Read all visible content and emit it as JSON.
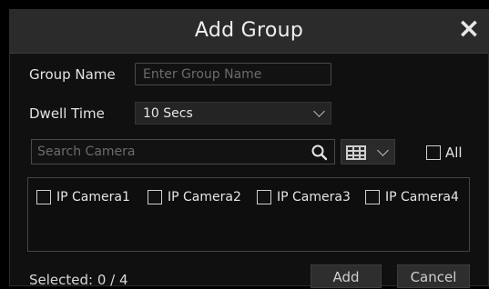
{
  "dialog": {
    "title": "Add Group",
    "close_icon": "×",
    "group_name": {
      "label": "Group Name",
      "placeholder": "Enter Group Name",
      "value": ""
    },
    "dwell_time": {
      "label": "Dwell Time",
      "value": "10 Secs"
    },
    "search": {
      "placeholder": "Search Camera",
      "icon": "search-icon"
    },
    "view_toggle": {
      "icon": "grid-view-icon"
    },
    "all_checkbox": {
      "label": "All",
      "checked": false
    },
    "cameras": [
      {
        "label": "IP Camera1",
        "checked": false
      },
      {
        "label": "IP Camera2",
        "checked": false
      },
      {
        "label": "IP Camera3",
        "checked": false
      },
      {
        "label": "IP Camera4",
        "checked": false
      }
    ],
    "footer": {
      "selected_text": "Selected: 0 / 4",
      "add_label": "Add",
      "cancel_label": "Cancel"
    }
  }
}
